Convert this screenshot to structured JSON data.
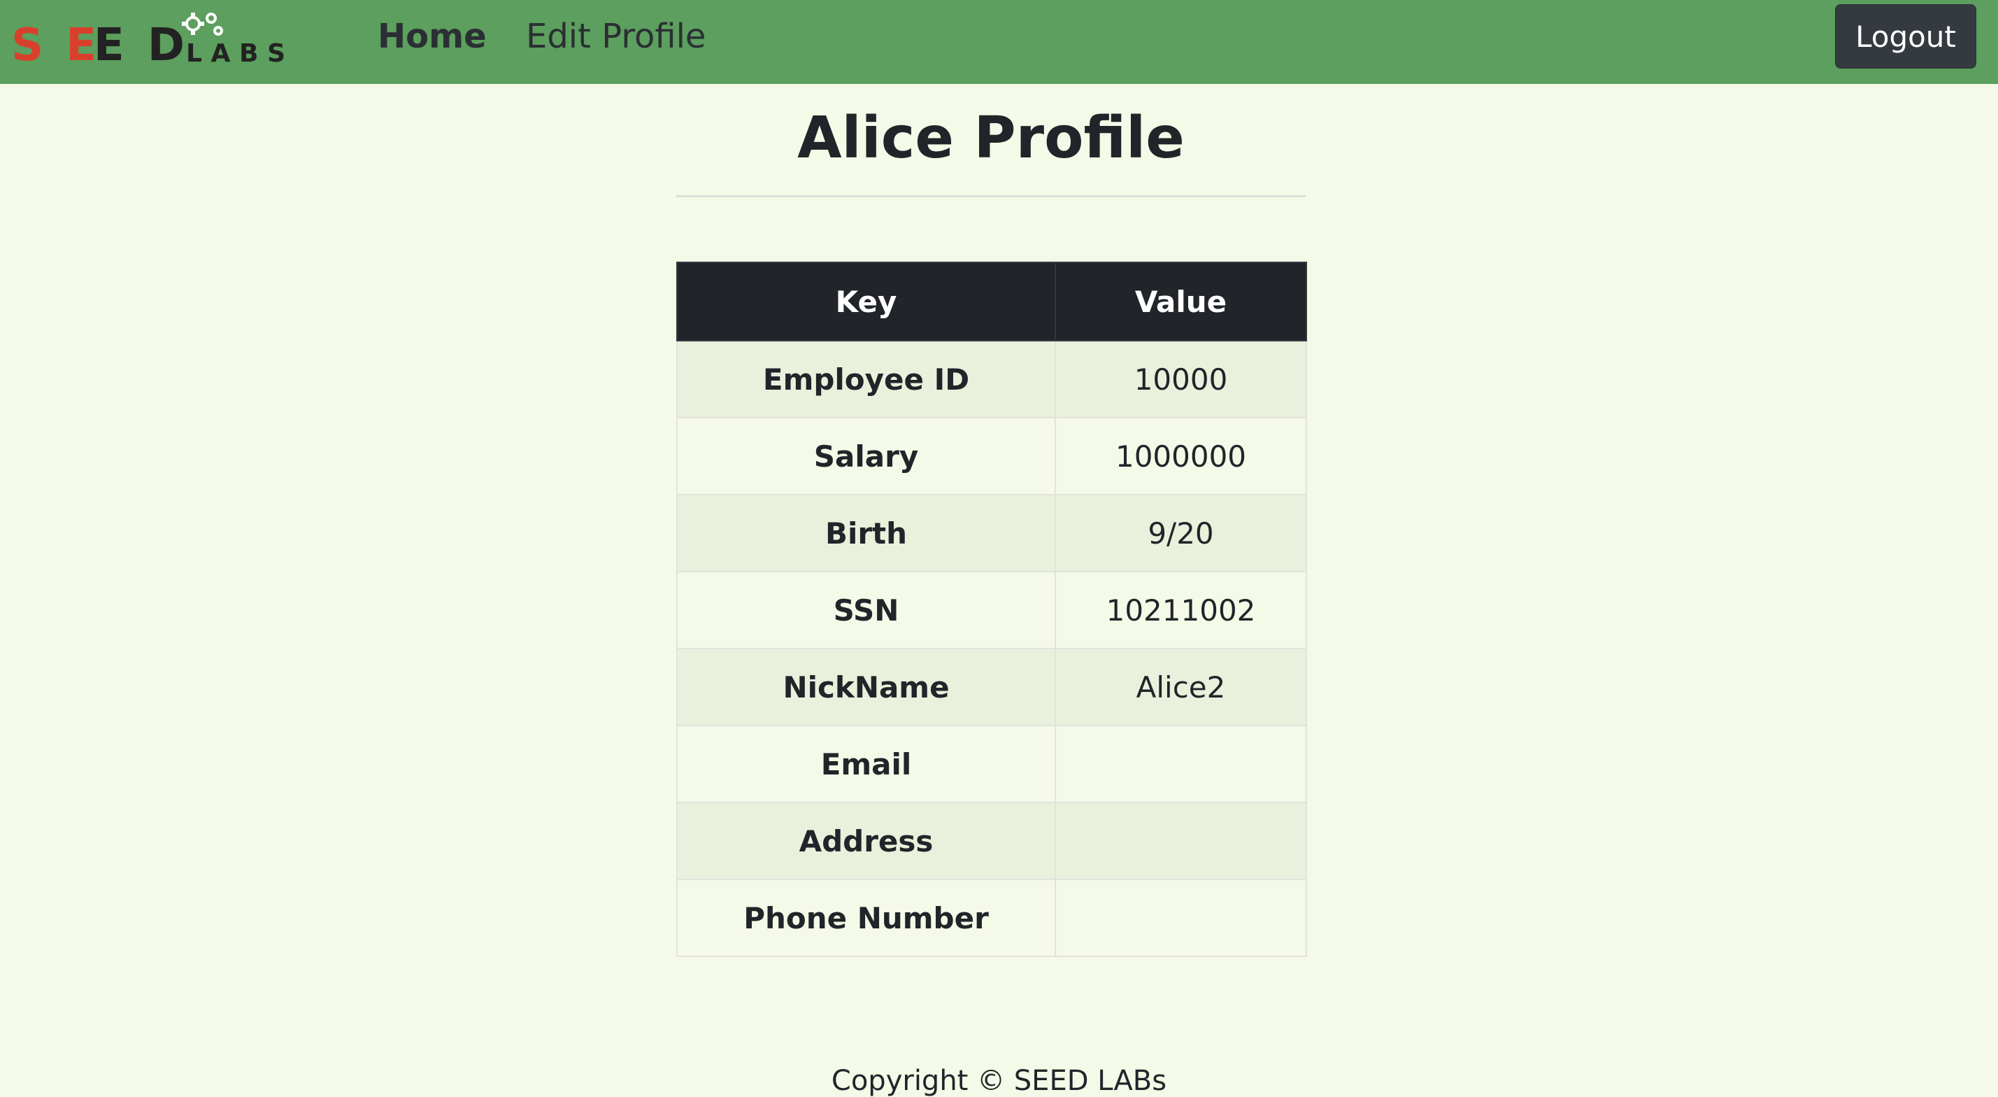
{
  "navbar": {
    "logo_text": "SEEDLABS",
    "home_label": "Home",
    "edit_profile_label": "Edit Profile",
    "logout_label": "Logout",
    "background_color": "#5c9f5e"
  },
  "main": {
    "title": "Alice Profile",
    "table": {
      "headers": [
        "Key",
        "Value"
      ],
      "rows": [
        {
          "key": "Employee ID",
          "value": "10000"
        },
        {
          "key": "Salary",
          "value": "1000000"
        },
        {
          "key": "Birth",
          "value": "9/20"
        },
        {
          "key": "SSN",
          "value": "10211002"
        },
        {
          "key": "NickName",
          "value": "Alice2"
        },
        {
          "key": "Email",
          "value": ""
        },
        {
          "key": "Address",
          "value": ""
        },
        {
          "key": "Phone Number",
          "value": ""
        }
      ]
    }
  },
  "footer": {
    "copyright": "Copyright © SEED LABs"
  }
}
